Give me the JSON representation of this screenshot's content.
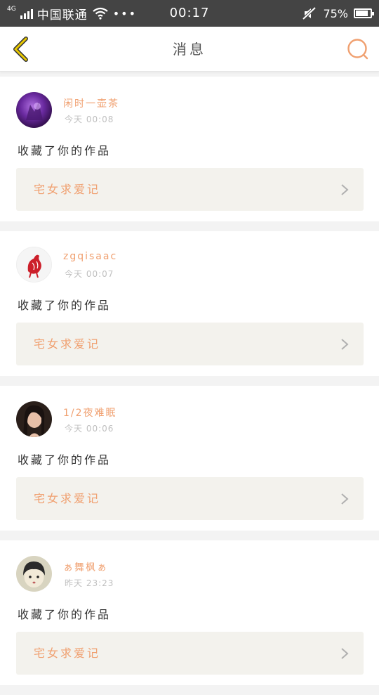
{
  "status_bar": {
    "network": "4G",
    "carrier": "中国联通",
    "more": "•••",
    "time": "00:17",
    "battery_text": "75%",
    "battery_level": 0.75
  },
  "nav": {
    "title": "消息",
    "back_icon": "chevron-left-icon",
    "search_icon": "search-icon",
    "accent_color": "#f0a070",
    "back_color": "#d4b400"
  },
  "messages": [
    {
      "username": "闲时一壶茶",
      "time": "今天 00:08",
      "action": "收藏了你的作品",
      "work_title": "宅女求爱记"
    },
    {
      "username": "zgqisaac",
      "time": "今天 00:07",
      "action": "收藏了你的作品",
      "work_title": "宅女求爱记"
    },
    {
      "username": "1/2夜难眠",
      "time": "今天 00:06",
      "action": "收藏了你的作品",
      "work_title": "宅女求爱记"
    },
    {
      "username": "ぁ舞枫ぁ",
      "time": "昨天 23:23",
      "action": "收藏了你的作品",
      "work_title": "宅女求爱记"
    }
  ]
}
